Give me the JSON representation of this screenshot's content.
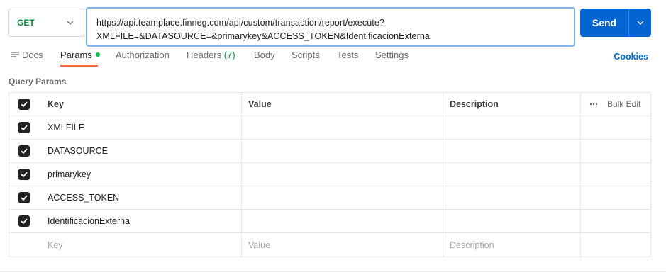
{
  "request": {
    "method": "GET",
    "url_line1": "https://api.teamplace.finneg.com/api/custom/transaction/report/execute?",
    "url_line2": "XMLFILE=&DATASOURCE=&primarykey&ACCESS_TOKEN&IdentificacionExterna",
    "send_label": "Send"
  },
  "tabs": {
    "docs": "Docs",
    "params": "Params",
    "authorization": "Authorization",
    "headers": "Headers",
    "headers_count": "(7)",
    "body": "Body",
    "scripts": "Scripts",
    "tests": "Tests",
    "settings": "Settings",
    "cookies": "Cookies"
  },
  "query_params": {
    "title": "Query Params",
    "headers": {
      "key": "Key",
      "value": "Value",
      "description": "Description",
      "bulk_edit": "Bulk Edit"
    },
    "rows": [
      {
        "key": "XMLFILE",
        "value": "",
        "description": "",
        "checked": true
      },
      {
        "key": "DATASOURCE",
        "value": "",
        "description": "",
        "checked": true
      },
      {
        "key": "primarykey",
        "value": "",
        "description": "",
        "checked": true
      },
      {
        "key": "ACCESS_TOKEN",
        "value": "",
        "description": "",
        "checked": true
      },
      {
        "key": "IdentificacionExterna",
        "value": "",
        "description": "",
        "checked": true
      }
    ],
    "placeholders": {
      "key": "Key",
      "value": "Value",
      "description": "Description"
    }
  },
  "colors": {
    "send": "#0265d2",
    "method": "#0c8a3c",
    "active_tab_underline": "#ff6c37",
    "params_dot": "#0cbb52",
    "cookies": "#0265d2"
  }
}
